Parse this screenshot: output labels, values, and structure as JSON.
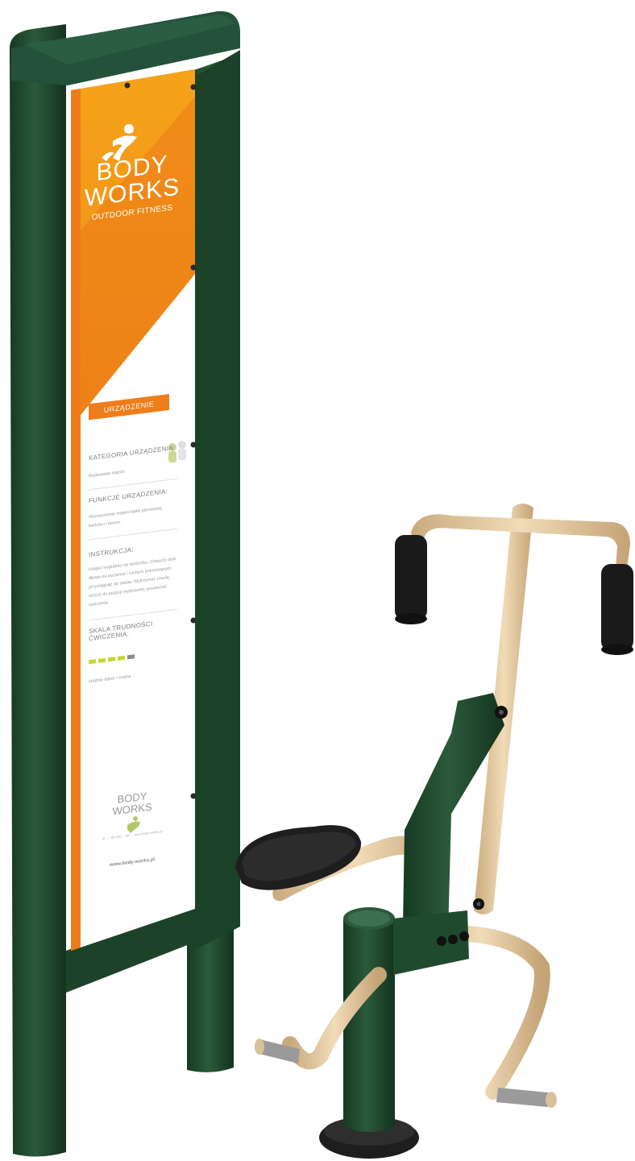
{
  "sign": {
    "logo_line1": "BODY",
    "logo_line2": "WORKS",
    "logo_tagline": "OUTDOOR FITNESS",
    "section_header": "URZĄDZENIE",
    "category_heading": "KATEGORIA URZĄDZENIA:",
    "category_text": "Budowanie mięśni",
    "functions_heading": "FUNKCJE URZĄDZENIA:",
    "functions_text": "Wzmacnianie mięśni klatki piersiowej, barków i ramion.",
    "instruction_heading": "INSTRUKCJA:",
    "instruction_text": "Usiąść wygodnie na siedzisku. Chwycić obie dłonie na poziomie i ruchem jednostajnym przyciągnąć do siebie. Wytrzymać chwilę, wrócić do pozycji wyjściowej, powtarzać ćwiczenie.",
    "scale_heading": "SKALA TRUDNOŚCI ĆWICZENIA:",
    "difficulty_level": 4,
    "difficulty_max": 5,
    "scale_text": "średnio łatwe / trudne",
    "footer_logo_line1": "BODY",
    "footer_logo_line2": "WORKS",
    "footer_address": "ul. ..., 00-000 ... tel. ... www.body-works.pl",
    "website": "www.body-works.pl"
  },
  "colors": {
    "frame_green": "#1f4a2e",
    "panel_orange": "#ef7d1c",
    "panel_orange_dark": "#e8661a",
    "panel_white": "#ffffff",
    "beige": "#e8cfa8",
    "grip_black": "#1a1a1a",
    "difficulty_on": "#c7d62a",
    "difficulty_off": "#8a8a8a"
  }
}
